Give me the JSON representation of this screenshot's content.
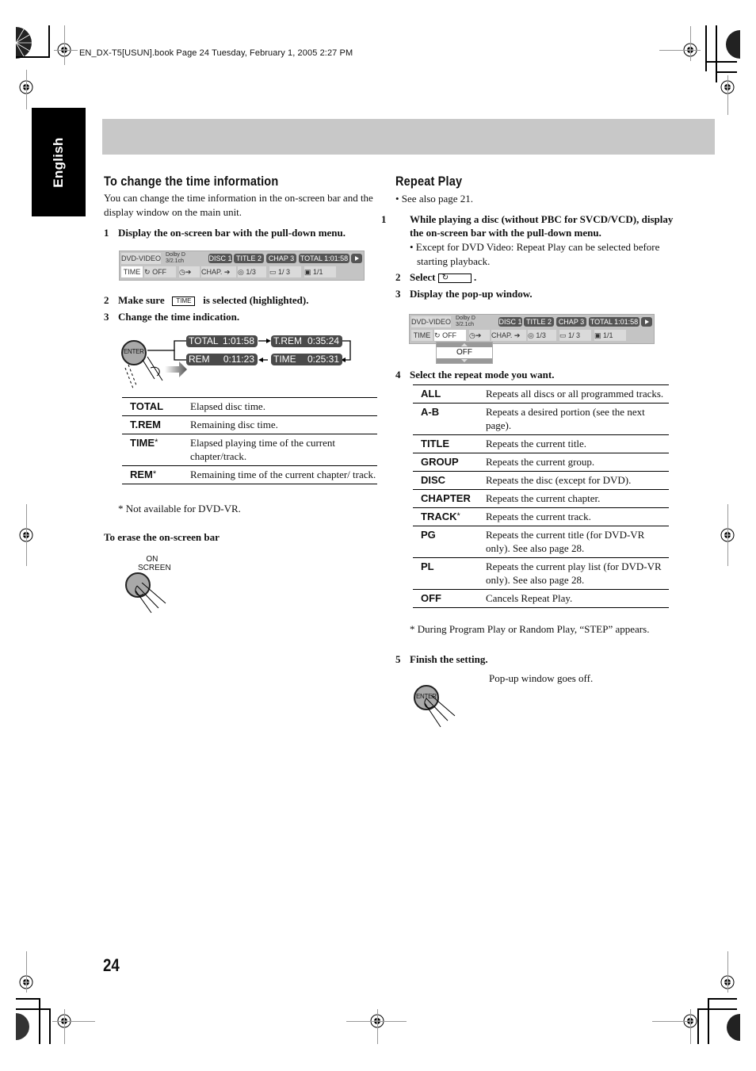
{
  "header": {
    "meta": "EN_DX-T5[USUN].book  Page 24  Tuesday, February 1, 2005  2:27 PM"
  },
  "language_tab": "English",
  "left": {
    "title": "To change the time information",
    "intro": "You can change the time information in the on-screen bar and the display window on the main unit.",
    "steps": [
      {
        "num": "1",
        "text": "Display the on-screen bar with the pull-down menu."
      },
      {
        "num": "2",
        "text_before": "Make sure",
        "box": "TIME",
        "text_after": "is selected (highlighted)."
      },
      {
        "num": "3",
        "text": "Change the time indication."
      }
    ],
    "osd": {
      "source": "DVD-VIDEO",
      "audio_line1": "Dolby D",
      "audio_line2": "3/2.1ch",
      "disc": "DISC 1",
      "title": "TITLE  2",
      "chap": "CHAP  3",
      "total": "TOTAL   1:01:58",
      "time": "TIME",
      "repeat": "OFF",
      "chap_arrow": "CHAP.",
      "audio": "1/3",
      "subtitle": "1/ 3",
      "angle": "1/1"
    },
    "enter_label": "ENTER",
    "cycle": [
      {
        "label": "TOTAL",
        "value": "1:01:58"
      },
      {
        "label": "T.REM",
        "value": "0:35:24"
      },
      {
        "label": "TIME",
        "value": "0:25:31"
      },
      {
        "label": "REM",
        "value": "0:11:23"
      }
    ],
    "table": [
      {
        "key": "TOTAL",
        "star": "",
        "desc": "Elapsed disc time."
      },
      {
        "key": "T.REM",
        "star": "",
        "desc": "Remaining disc time."
      },
      {
        "key": "TIME",
        "star": "*",
        "desc": "Elapsed playing time of the current chapter/track."
      },
      {
        "key": "REM",
        "star": "*",
        "desc": "Remaining time of the current chapter/ track."
      }
    ],
    "footnote": "* Not available for DVD-VR.",
    "erase_title": "To erase the on-screen bar",
    "on_screen_line1": "ON",
    "on_screen_line2": "SCREEN"
  },
  "right": {
    "title": "Repeat Play",
    "see_also": "• See also page 21.",
    "step1": {
      "num": "1",
      "text": "While playing a disc (without PBC for SVCD/VCD), display the on-screen bar with the pull-down menu."
    },
    "step1_note": "• Except for DVD Video: Repeat Play can be selected before starting playback.",
    "step2": {
      "num": "2",
      "text": "Select"
    },
    "step3": {
      "num": "3",
      "text": "Display the pop-up window."
    },
    "popup_value": "OFF",
    "step4": {
      "num": "4",
      "text": "Select the repeat mode you want."
    },
    "table": [
      {
        "key": "ALL",
        "star": "",
        "desc": "Repeats all discs or all programmed tracks."
      },
      {
        "key": "A-B",
        "star": "",
        "desc": "Repeats a desired portion (see the next page)."
      },
      {
        "key": "TITLE",
        "star": "",
        "desc": "Repeats the current title."
      },
      {
        "key": "GROUP",
        "star": "",
        "desc": "Repeats the current group."
      },
      {
        "key": "DISC",
        "star": "",
        "desc": "Repeats the disc (except for DVD)."
      },
      {
        "key": "CHAPTER",
        "star": "",
        "desc": "Repeats the current chapter."
      },
      {
        "key": "TRACK",
        "star": "*",
        "desc": "Repeats the current track."
      },
      {
        "key": "PG",
        "star": "",
        "desc": "Repeats the current title (for DVD-VR only). See also page 28."
      },
      {
        "key": "PL",
        "star": "",
        "desc": "Repeats the current play list (for DVD-VR only). See also page 28."
      },
      {
        "key": "OFF",
        "star": "",
        "desc": "Cancels Repeat Play."
      }
    ],
    "footnote": "* During Program Play or Random Play, “STEP” appears.",
    "step5": {
      "num": "5",
      "text": "Finish the setting."
    },
    "result": "Pop-up window goes off.",
    "enter_label": "ENTER"
  },
  "page_number": "24"
}
